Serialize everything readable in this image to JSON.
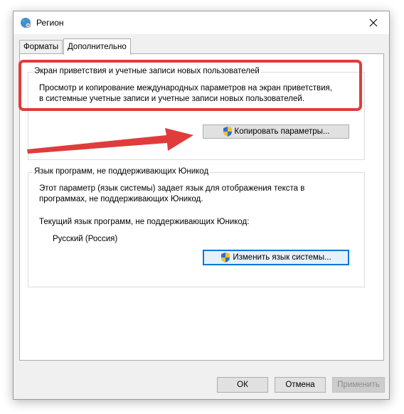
{
  "window": {
    "title": "Регион"
  },
  "tabs": [
    {
      "label": "Форматы",
      "active": false
    },
    {
      "label": "Дополнительно",
      "active": true
    }
  ],
  "welcome_group": {
    "legend": "Экран приветствия и учетные записи новых пользователей",
    "description_line1": "Просмотр и копирование международных параметров на экран приветствия,",
    "description_line2": "в системные учетные записи и учетные записи новых пользователей.",
    "copy_button": "Копировать параметры..."
  },
  "unicode_group": {
    "legend": "Язык программ, не поддерживающих Юникод",
    "description_line1": "Этот параметр (язык системы) задает язык для отображения текста в",
    "description_line2": "программах, не поддерживающих Юникод.",
    "current_label": "Текущий язык программ, не поддерживающих Юникод:",
    "current_value": "Русский (Россия)",
    "change_button": "Изменить язык системы..."
  },
  "footer": {
    "ok": "ОК",
    "cancel": "Отмена",
    "apply": "Применить"
  },
  "colors": {
    "annotation_red": "#e03c3c",
    "focus_blue": "#0078d7"
  }
}
